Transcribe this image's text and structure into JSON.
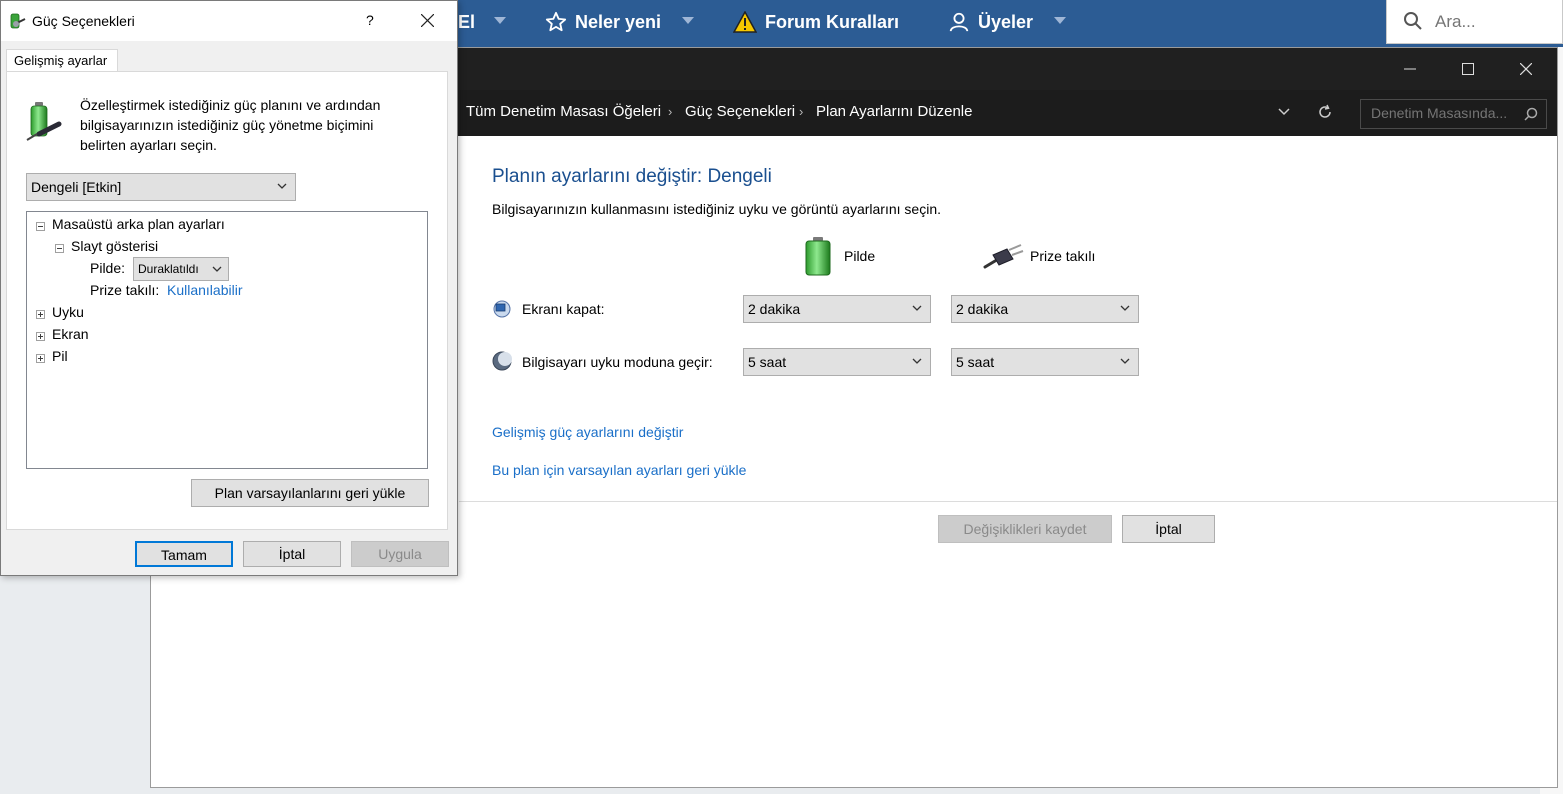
{
  "forum_nav": {
    "partial_item": "El",
    "whats_new": "Neler yeni",
    "forum_rules": "Forum Kuralları",
    "members": "Üyeler",
    "search_placeholder": "Ara..."
  },
  "control_panel": {
    "breadcrumbs": [
      "Tüm Denetim Masası Öğeleri",
      "Güç Seçenekleri",
      "Plan Ayarlarını Düzenle"
    ],
    "search_placeholder": "Denetim Masasında...",
    "heading": "Planın ayarlarını değiştir: Dengeli",
    "subheading": "Bilgisayarınızın kullanmasını istediğiniz uyku ve görüntü ayarlarını seçin.",
    "column_battery": "Pilde",
    "column_plugged": "Prize takılı",
    "rows": [
      {
        "label": "Ekranı kapat:",
        "battery": "2 dakika",
        "plugged": "2 dakika"
      },
      {
        "label": "Bilgisayarı uyku moduna geçir:",
        "battery": "5 saat",
        "plugged": "5 saat"
      }
    ],
    "link_advanced": "Gelişmiş güç ayarlarını değiştir",
    "link_restore": "Bu plan için varsayılan ayarları geri yükle",
    "save_button": "Değişiklikleri kaydet",
    "cancel_button": "İptal"
  },
  "dialog": {
    "title": "Güç Seçenekleri",
    "help": "?",
    "tab": "Gelişmiş ayarlar",
    "description": "Özelleştirmek istediğiniz güç planını ve ardından bilgisayarınızın istediğiniz güç yönetme biçimini belirten ayarları seçin.",
    "plan_select": "Dengeli [Etkin]",
    "tree": {
      "desktop_bg": "Masaüstü arka plan ayarları",
      "slideshow": "Slayt gösterisi",
      "on_battery_label": "Pilde:",
      "on_battery_value": "Duraklatıldı",
      "plugged_label": "Prize takılı:",
      "plugged_value": "Kullanılabilir",
      "sleep": "Uyku",
      "display": "Ekran",
      "battery": "Pil"
    },
    "restore_button": "Plan varsayılanlarını geri yükle",
    "ok_button": "Tamam",
    "cancel_button": "İptal",
    "apply_button": "Uygula"
  },
  "colors": {
    "forum_bar": "#2c5c94",
    "titlebar_dark": "#202020",
    "link_blue": "#1a6fc8",
    "heading_blue": "#1a4f8f"
  }
}
